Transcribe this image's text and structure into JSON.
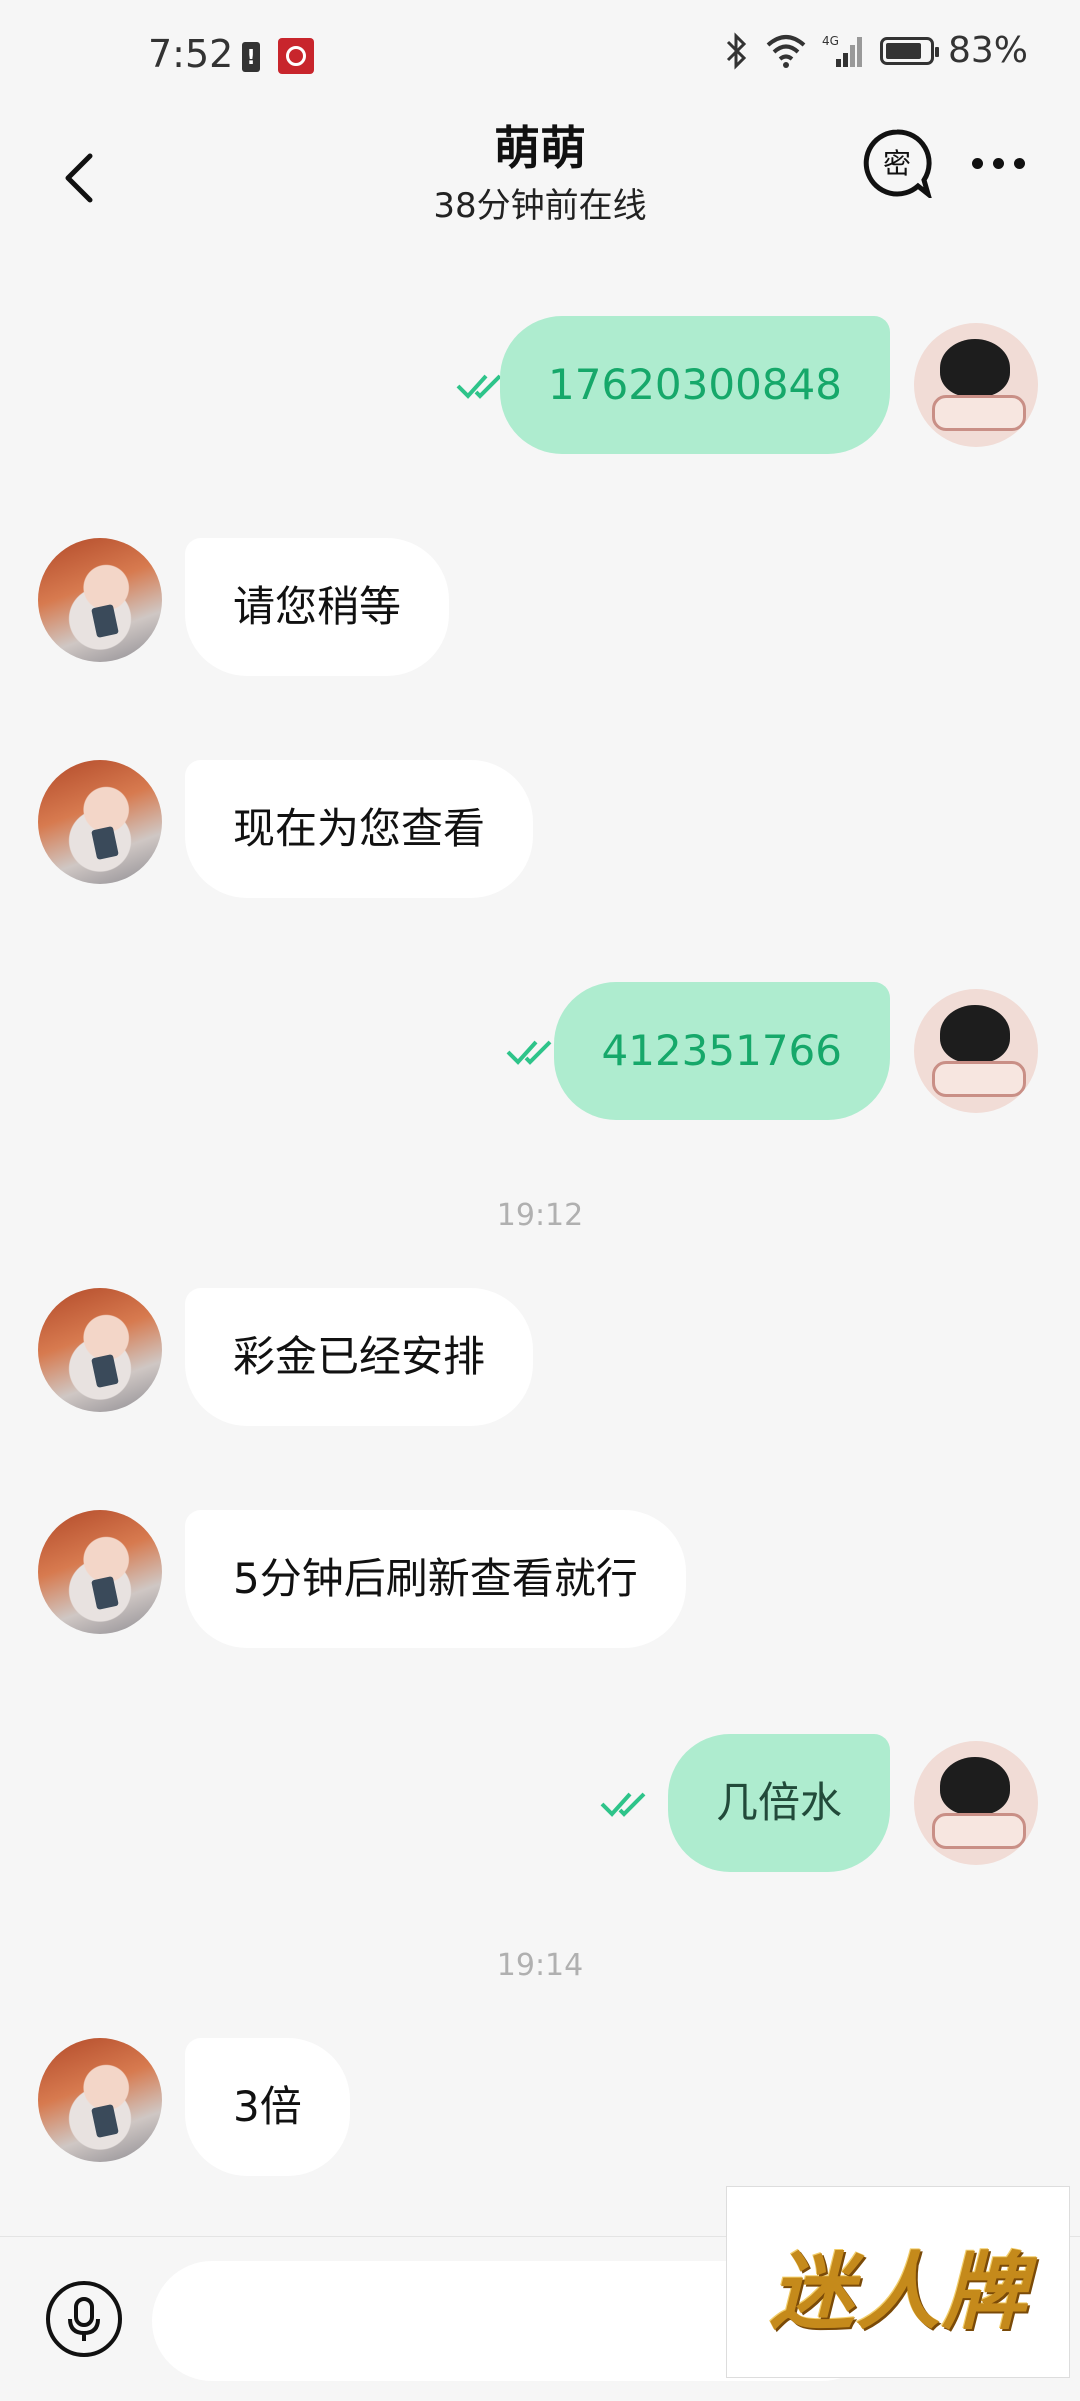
{
  "status_bar": {
    "time": "7:52",
    "battery_percent_text": "83%",
    "battery_level": 0.83,
    "network": "4G"
  },
  "header": {
    "title": "萌萌",
    "subtitle": "38分钟前在线",
    "secret_chat_label": "密"
  },
  "messages": [
    {
      "side": "out",
      "text": "17620300848",
      "read": true
    },
    {
      "side": "in",
      "text": "请您稍等"
    },
    {
      "side": "in",
      "text": "现在为您查看"
    },
    {
      "side": "out",
      "text": "412351766",
      "read": true
    },
    {
      "side": "time",
      "text": "19:12"
    },
    {
      "side": "in",
      "text": "彩金已经安排"
    },
    {
      "side": "in",
      "text": "5分钟后刷新查看就行"
    },
    {
      "side": "out",
      "text": "几倍水",
      "read": true
    },
    {
      "side": "time",
      "text": "19:14"
    },
    {
      "side": "in",
      "text": "3倍"
    }
  ],
  "input": {
    "placeholder": ""
  },
  "watermark": {
    "text": "迷人牌"
  },
  "colors": {
    "outgoing_bubble": "#aeeccf",
    "outgoing_text": "#16a86a",
    "incoming_bubble": "#ffffff",
    "background": "#f6f6f6",
    "read_tick": "#2ec48a"
  }
}
